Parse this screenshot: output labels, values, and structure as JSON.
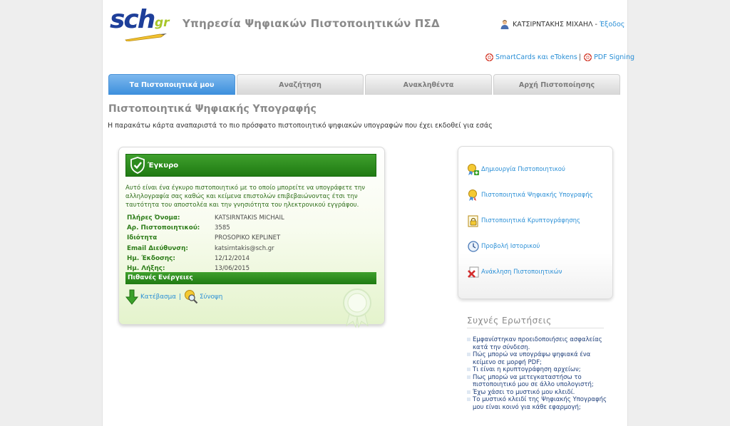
{
  "header": {
    "logo_text": "sch",
    "logo_gr": "gr",
    "site_title": "Υπηρεσία Ψηφιακών Πιστοποιητικών ΠΣΔ",
    "user_name": "ΚΑΤΣΙΡΝΤΑΚΗΣ ΜΙΧΑΗΛ -",
    "logout": "Έξοδος",
    "smartcards_link": "SmartCards και eTokens",
    "separator": "|",
    "pdf_signing_link": "PDF Signing"
  },
  "tabs": [
    {
      "label": "Τα Πιστοποιητικά μου",
      "active": true
    },
    {
      "label": "Αναζήτηση",
      "active": false
    },
    {
      "label": "Ανακληθέντα",
      "active": false
    },
    {
      "label": "Αρχή Πιστοποίησης",
      "active": false
    }
  ],
  "page": {
    "heading": "Πιστοποιητικά Ψηφιακής Υπογραφής",
    "intro": "Η παρακάτω κάρτα αναπαριστά το πιο πρόσφατο πιστοποιητικό ψηφιακών υπογραφών που έχει εκδοθεί για εσάς"
  },
  "certificate": {
    "status": "Έγκυρο",
    "description": "Αυτό είναι ένα έγκυρο πιστοποιητικό με το οποίο μπορείτε να υπογράφετε την αλληλογραφία σας καθώς και κείμενα επιστολών επιβεβαιώνοντας έτσι την ταυτότητα του αποστολέα και την γνησιότητα του ηλεκτρονικού εγγράφου.",
    "fields": [
      {
        "label": "Πλήρες Όνομα:",
        "value": "KATSIRNTAKIS MICHAIL"
      },
      {
        "label": "Αρ. Πιστοποιητικού:",
        "value": "3585"
      },
      {
        "label": "Ιδιότητα",
        "value": "PROSOPIKO KEPLINET"
      },
      {
        "label": "Email Διεύθυνση:",
        "value": "katsirntakis@sch.gr"
      },
      {
        "label": "Ημ. Έκδοσης:",
        "value": "12/12/2014"
      },
      {
        "label": "Ημ. Λήξης:",
        "value": "13/06/2015"
      }
    ],
    "actions_title": "Πιθανές Ενέργειες",
    "download": "Κατέβασμα",
    "action_separator": "|",
    "summary": "Σύνοψη"
  },
  "sidebar": {
    "items": [
      {
        "label": "Δημιουργία Πιστοποιητικού",
        "icon": "create-certificate-icon"
      },
      {
        "label": "Πιστοποιητικά Ψηφιακής Υπογραφής",
        "icon": "signature-certificate-icon"
      },
      {
        "label": "Πιστοποιητικά Κρυπτογράφησης",
        "icon": "encryption-certificate-icon"
      },
      {
        "label": "Προβολή Ιστορικού",
        "icon": "history-clock-icon"
      },
      {
        "label": "Ανάκληση Πιστοποιητικών",
        "icon": "revoke-certificate-icon"
      }
    ]
  },
  "faq": {
    "title": "Συχνές Ερωτήσεις",
    "items": [
      "Εμφανίστηκαν προειδοποιήσεις ασφαλείας κατά την σύνδεση.",
      "Πώς μπορώ να υπογράψω ψηφιακά ένα κείμενο σε μορφή PDF;",
      "Τι είναι η κρυπτογράφηση αρχείων;",
      "Πως μπορώ να μετεγκαταστήσω το πιστοποιητικό μου σε άλλο υπολογιστή;",
      "Έχω χάσει το μυστικό μου κλειδί.",
      "Το μυστικό κλειδί της Ψηφιακής Υπογραφής μου είναι κοινό για κάθε εφαρμογή;"
    ]
  },
  "colors": {
    "accent_blue": "#3c8fdc",
    "link_blue": "#2a8fd6",
    "valid_green": "#1f7a12"
  }
}
